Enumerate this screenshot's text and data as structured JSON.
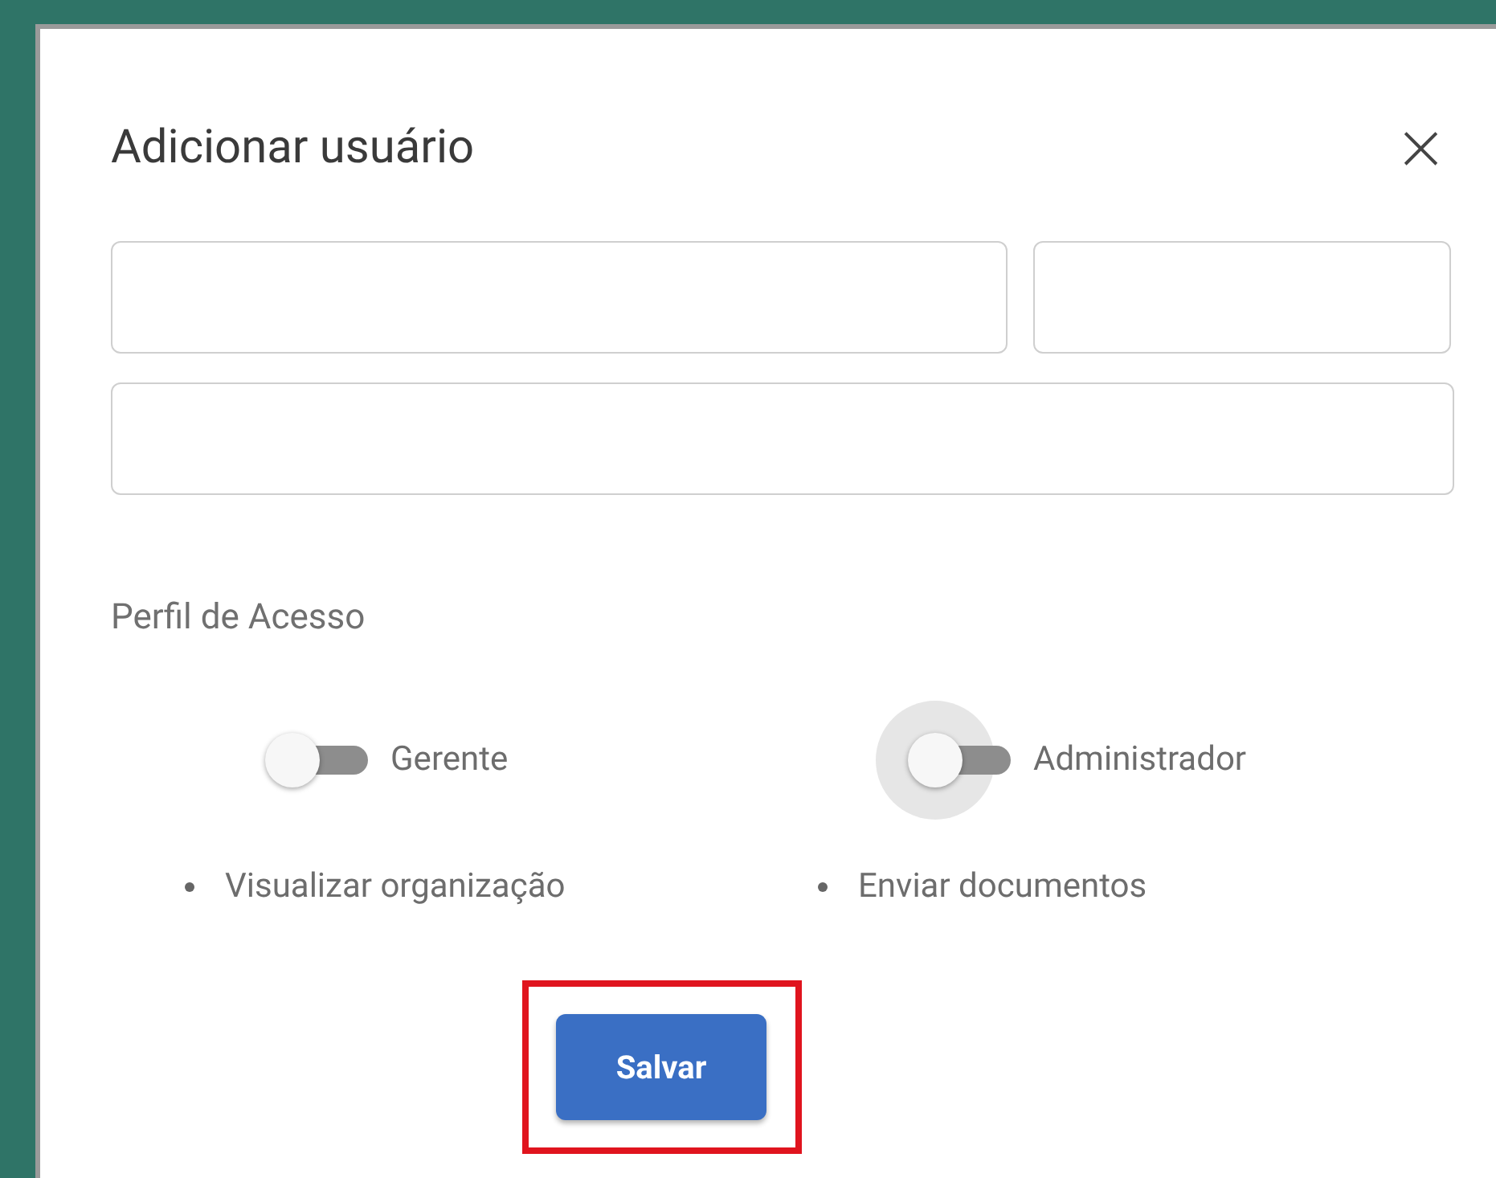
{
  "dialog": {
    "title": "Adicionar usuário",
    "close": "×"
  },
  "section_title": "Perfil de Acesso",
  "roles": [
    {
      "label": "Gerente",
      "on": false,
      "focused": false,
      "permission": "Visualizar organização"
    },
    {
      "label": "Administrador",
      "on": false,
      "focused": true,
      "permission": "Enviar documentos"
    }
  ],
  "save_button": {
    "label": "Salvar",
    "highlighted": true
  }
}
